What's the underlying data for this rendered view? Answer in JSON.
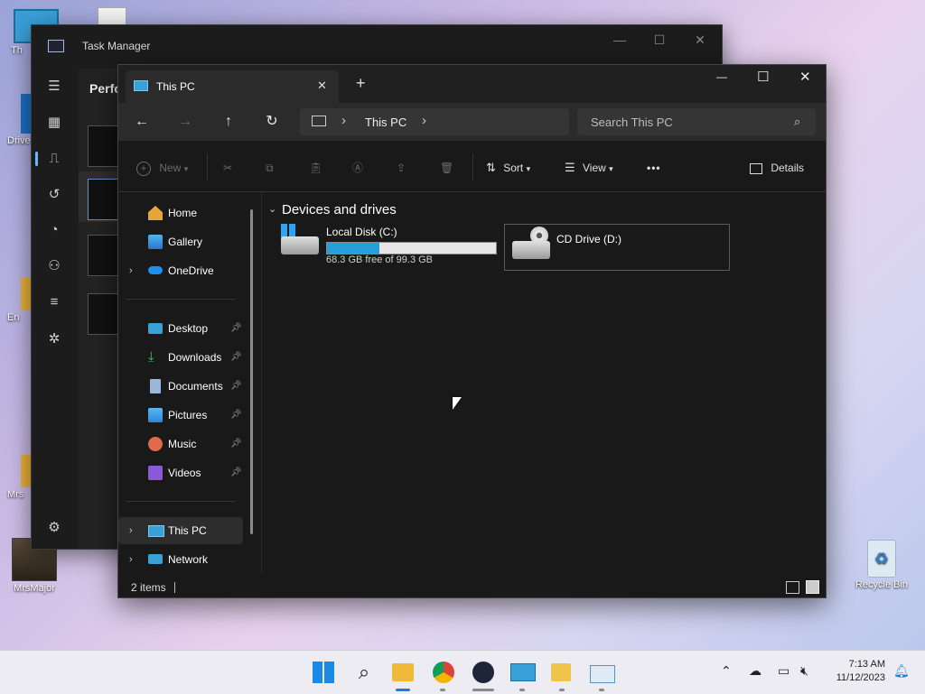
{
  "desktop": {
    "icons": [
      {
        "name": "This PC",
        "label": "Th"
      },
      {
        "name": "Drive",
        "label": "Drive"
      },
      {
        "name": "Folder",
        "label": "En"
      },
      {
        "name": "Folder2",
        "label": "Mrs"
      },
      {
        "name": "MrsMajor",
        "label": "MrsMajor"
      },
      {
        "name": "Recycle Bin",
        "label": "Recycle Bin"
      }
    ]
  },
  "taskmanager": {
    "title": "Task Manager",
    "page_title": "Perfo"
  },
  "explorer": {
    "tab_title": "This PC",
    "tab_close": "✕",
    "new_tab": "+",
    "window_controls": {
      "minimize": "—",
      "maximize": "☐",
      "close": "✕"
    },
    "address": {
      "crumb": "This PC",
      "sep": "›"
    },
    "search": {
      "placeholder": "Search This PC"
    },
    "commands": {
      "new": "New",
      "sort": "Sort",
      "view": "View",
      "more": "•••",
      "details": "Details"
    },
    "sidebar": {
      "items": [
        {
          "label": "Home"
        },
        {
          "label": "Gallery"
        },
        {
          "label": "OneDrive"
        },
        {
          "label": "Desktop"
        },
        {
          "label": "Downloads"
        },
        {
          "label": "Documents"
        },
        {
          "label": "Pictures"
        },
        {
          "label": "Music"
        },
        {
          "label": "Videos"
        },
        {
          "label": "This PC"
        },
        {
          "label": "Network"
        }
      ]
    },
    "group_header": "Devices and drives",
    "drives": [
      {
        "name": "Local Disk (C:)",
        "free_text": "68.3 GB free of 99.3 GB",
        "used_fraction": 0.312
      },
      {
        "name": "CD Drive (D:)"
      }
    ],
    "status": {
      "items": "2 items"
    }
  },
  "taskbar": {
    "apps": [
      "start-icon",
      "search-icon",
      "file-explorer-icon",
      "chrome-icon",
      "unreal-icon",
      "remote-desktop-icon",
      "onedrive-folder-icon",
      "task-manager-icon"
    ],
    "time": "7:13 AM",
    "date": "11/12/2023"
  },
  "colors": {
    "explorer_bg": "#191919",
    "accent": "#26a0da",
    "taskbar_bg": "#ececf2"
  }
}
